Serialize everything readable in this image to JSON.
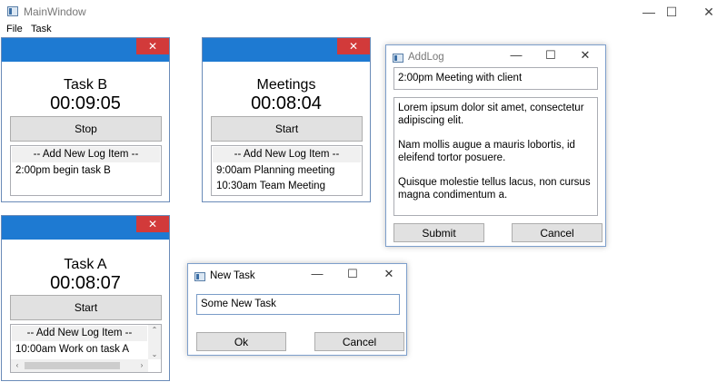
{
  "main_window": {
    "title": "MainWindow",
    "controls": {
      "minimize": "—",
      "maximize": "☐",
      "close": "✕"
    }
  },
  "menu": {
    "items": [
      "File",
      "Task"
    ]
  },
  "task_windows": [
    {
      "name": "Task B",
      "time": "00:09:05",
      "button": "Stop",
      "add_log": "-- Add New Log Item --",
      "logs": [
        "2:00pm begin task B"
      ]
    },
    {
      "name": "Meetings",
      "time": "00:08:04",
      "button": "Start",
      "add_log": "-- Add New Log Item --",
      "logs": [
        "9:00am Planning meeting",
        "10:30am Team Meeting"
      ]
    },
    {
      "name": "Task A",
      "time": "00:08:07",
      "button": "Start",
      "add_log": "-- Add New Log Item --",
      "logs": [
        "10:00am Work on task A"
      ]
    }
  ],
  "close_glyph": "✕",
  "add_log_dialog": {
    "title": "AddLog",
    "title_input": "2:00pm Meeting with client",
    "body_paragraphs": [
      "Lorem ipsum dolor sit amet, consectetur adipiscing elit.",
      "Nam mollis augue a mauris lobortis, id eleifend tortor posuere.",
      "Quisque molestie tellus lacus, non cursus magna condimentum a."
    ],
    "submit": "Submit",
    "cancel": "Cancel",
    "controls": {
      "minimize": "—",
      "maximize": "☐",
      "close": "✕"
    }
  },
  "new_task_dialog": {
    "title": "New Task",
    "input_value": "Some New Task",
    "ok": "Ok",
    "cancel": "Cancel",
    "controls": {
      "minimize": "—",
      "maximize": "☐",
      "close": "✕"
    }
  },
  "colors": {
    "titlebar_blue": "#1e7ad2",
    "close_red": "#d23a3a"
  }
}
